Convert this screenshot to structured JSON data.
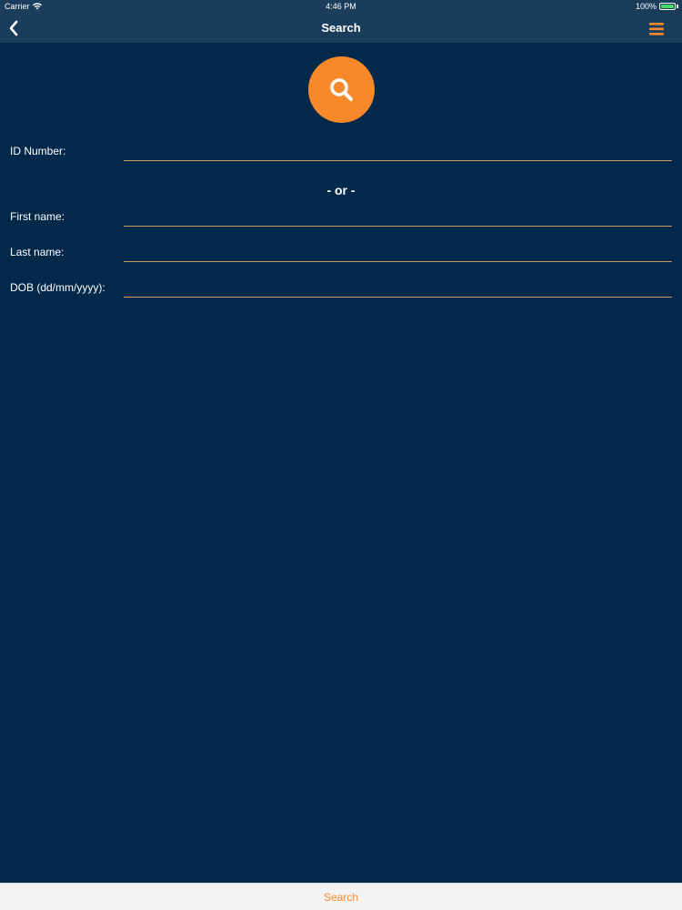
{
  "status_bar": {
    "carrier": "Carrier",
    "time": "4:46 PM",
    "battery_text": "100%",
    "battery_level": 1.0,
    "wifi_icon": "wifi-icon",
    "battery_color": "#4cd964"
  },
  "nav": {
    "title": "Search",
    "back_icon": "chevron-left-icon",
    "menu_icon": "hamburger-menu-icon",
    "menu_color": "#f7892a"
  },
  "search_button": {
    "icon": "search-icon",
    "color": "#f7892a"
  },
  "form": {
    "id_number": {
      "label": "ID Number:",
      "value": "",
      "placeholder": ""
    },
    "separator": "- or -",
    "first_name": {
      "label": "First name:",
      "value": "",
      "placeholder": ""
    },
    "last_name": {
      "label": "Last name:",
      "value": "",
      "placeholder": ""
    },
    "dob": {
      "label": "DOB (dd/mm/yyyy):",
      "value": "",
      "placeholder": ""
    }
  },
  "bottom_bar": {
    "search_label": "Search"
  },
  "colors": {
    "background": "#02284a",
    "nav_background": "#1b3d5c",
    "accent": "#f7892a",
    "field_underline": "#c79a5a"
  }
}
